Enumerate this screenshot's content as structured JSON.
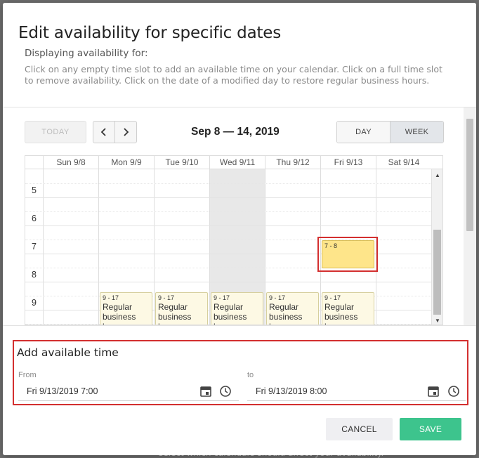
{
  "backdrop": {
    "bottom_text": "select which calendars should affect your availability."
  },
  "modal": {
    "title": "Edit availability for specific dates",
    "subtitle": "Displaying availability for:",
    "instructions": "Click on any empty time slot to add an available time on your calendar. Click on a full time slot to remove availability. Click on the date of a modified day to restore regular business hours."
  },
  "toolbar": {
    "today_label": "TODAY",
    "prev_icon": "chevron-left",
    "next_icon": "chevron-right",
    "date_range": "Sep 8 — 14, 2019",
    "day_label": "DAY",
    "week_label": "WEEK",
    "active_view": "WEEK"
  },
  "calendar": {
    "days": [
      {
        "label": "Sun 9/8",
        "disabled": false
      },
      {
        "label": "Mon 9/9",
        "disabled": false
      },
      {
        "label": "Tue 9/10",
        "disabled": false
      },
      {
        "label": "Wed 9/11",
        "disabled": true
      },
      {
        "label": "Thu 9/12",
        "disabled": false
      },
      {
        "label": "Fri 9/13",
        "disabled": false
      },
      {
        "label": "Sat 9/14",
        "disabled": false
      }
    ],
    "hours": [
      "5",
      "6",
      "7",
      "8",
      "9"
    ],
    "regular_events": [
      {
        "day": "Mon 9/9",
        "time": "9 - 17",
        "text": "Regular business hours"
      },
      {
        "day": "Tue 9/10",
        "time": "9 - 17",
        "text": "Regular business hours"
      },
      {
        "day": "Wed 9/11",
        "time": "9 - 17",
        "text": "Regular business hours"
      },
      {
        "day": "Thu 9/12",
        "time": "9 - 17",
        "text": "Regular business hours"
      },
      {
        "day": "Fri 9/13",
        "time": "9 - 17",
        "text": "Regular business hours"
      }
    ],
    "added_event": {
      "day": "Fri 9/13",
      "time": "7 - 8"
    }
  },
  "add_available": {
    "title": "Add available time",
    "from_label": "From",
    "from_value": "Fri 9/13/2019 7:00",
    "to_label": "to",
    "to_value": "Fri 9/13/2019 8:00"
  },
  "actions": {
    "cancel_label": "CANCEL",
    "save_label": "SAVE"
  },
  "colors": {
    "save": "#3dc48d",
    "highlight": "#d32f2f",
    "added_event": "#fee58a",
    "regular_event": "#fdf9e4"
  }
}
